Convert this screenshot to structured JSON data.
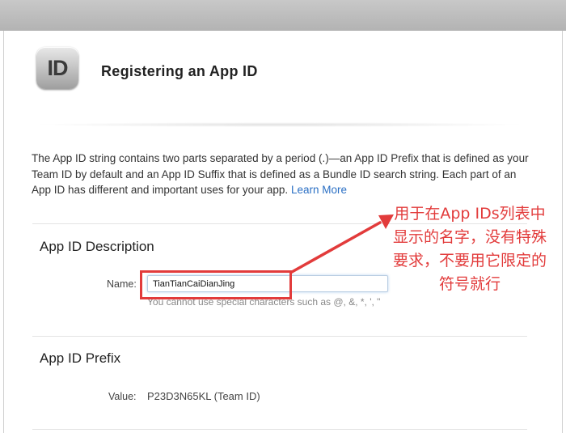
{
  "header": {
    "icon_text": "ID",
    "title": "Registering an App ID"
  },
  "intro": {
    "text": "The App ID string contains two parts separated by a period (.)—an App ID Prefix that is defined as your Team ID by default and an App ID Suffix that is defined as a Bundle ID search string. Each part of an App ID has different and important uses for your app.",
    "link_label": "Learn More"
  },
  "description_section": {
    "title": "App ID Description",
    "name_label": "Name:",
    "name_value": "TianTianCaiDianJing",
    "hint": "You cannot use special characters such as @, &, *, ', \""
  },
  "prefix_section": {
    "title": "App ID Prefix",
    "value_label": "Value:",
    "value": "P23D3N65KL (Team ID)"
  },
  "annotation": {
    "text": "用于在App IDs列表中显示的名字，没有特殊要求，不要用它限定的符号就行",
    "color": "#e23b3b"
  }
}
